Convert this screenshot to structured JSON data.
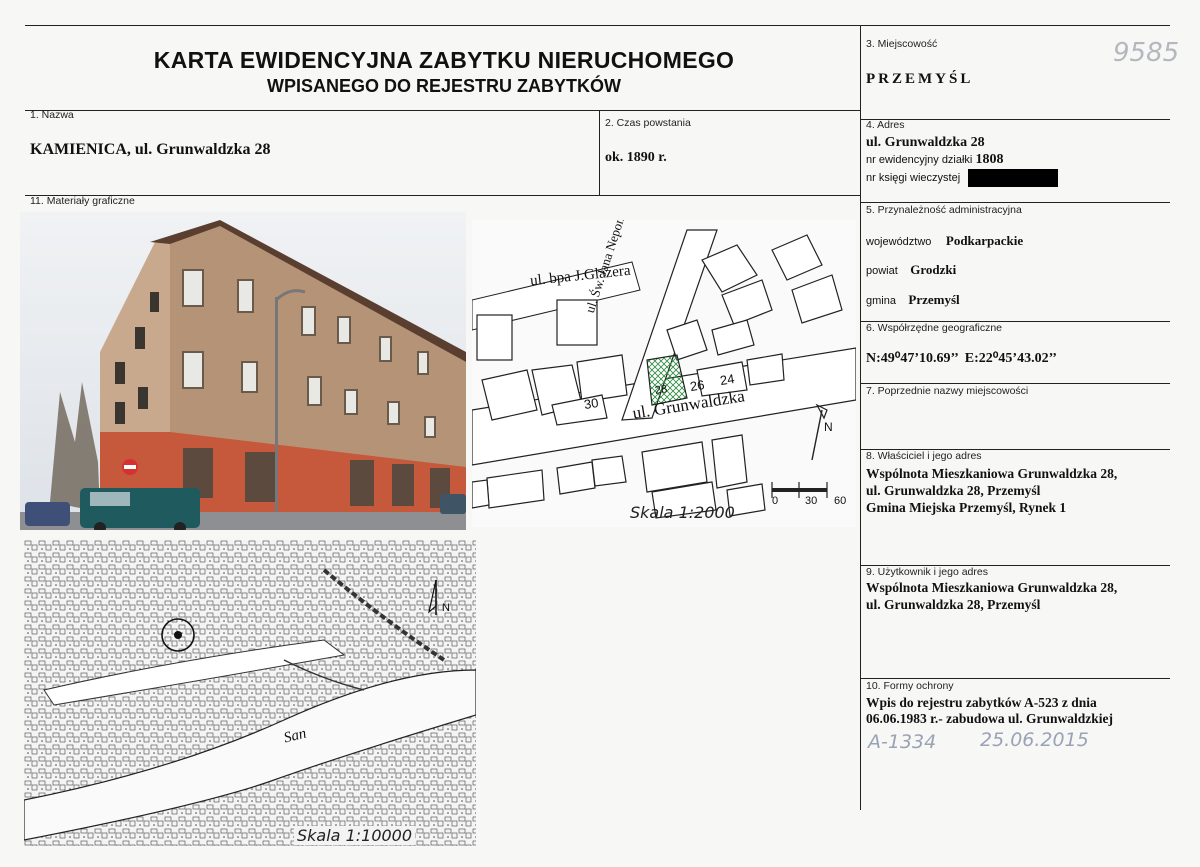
{
  "header": {
    "title_line1": "KARTA EWIDENCYJNA ZABYTKU NIERUCHOMEGO",
    "title_line2": "WPISANEGO DO REJESTRU ZABYTKÓW",
    "ref_number": "9585"
  },
  "fields": {
    "miejscowosc": {
      "label": "3. Miejscowość",
      "value": "PRZEMYŚL"
    },
    "nazwa": {
      "label": "1. Nazwa",
      "value": "KAMIENICA, ul. Grunwaldzka 28"
    },
    "czas_powstania": {
      "label": "2. Czas powstania",
      "value": "ok. 1890 r."
    },
    "adres": {
      "label": "4. Adres",
      "street": "ul. Grunwaldzka 28",
      "dzialka_label": "nr ewidencyjny działki",
      "dzialka_value": "1808",
      "ksiega_label": "nr księgi wieczystej"
    },
    "materialy": {
      "label": "11. Materiały graficzne"
    },
    "przynaleznosc": {
      "label": "5. Przynależność administracyjna",
      "wojewodztwo_label": "województwo",
      "wojewodztwo_value": "Podkarpackie",
      "powiat_label": "powiat",
      "powiat_value": "Grodzki",
      "gmina_label": "gmina",
      "gmina_value": "Przemyśl"
    },
    "wspolrzedne": {
      "label": "6. Współrzędne geograficzne",
      "value": "N:49⁰47’10.69’’  E:22⁰45’43.02’’"
    },
    "poprzednie_nazwy": {
      "label": "7. Poprzednie nazwy miejscowości"
    },
    "wlasciciel": {
      "label": "8. Właściciel i jego adres",
      "lines": [
        "Wspólnota Mieszkaniowa Grunwaldzka 28,",
        "ul. Grunwaldzka 28, Przemyśl",
        "Gmina Miejska Przemyśl, Rynek 1"
      ]
    },
    "uzytkownik": {
      "label": "9. Użytkownik i jego adres",
      "lines": [
        "Wspólnota Mieszkaniowa Grunwaldzka 28,",
        "ul. Grunwaldzka 28, Przemyśl"
      ]
    },
    "formy_ochrony": {
      "label": "10. Formy ochrony",
      "lines": [
        "Wpis do rejestru zabytków A-523 z dnia",
        "06.06.1983 r.- zabudowa ul. Grunwaldzkiej"
      ],
      "handwritten_number": "A-1334",
      "handwritten_date": "25.06.2015"
    }
  },
  "map_detail": {
    "street_glazera": "ul. bpa J.Glazera",
    "street_nepomucena": "ul. Św. Jana Nepomucena",
    "street_grunwaldzka": "ul. Grunwaldzka",
    "lot_28": "28",
    "lot_26": "26",
    "lot_24": "24",
    "lot_30": "30",
    "scale": "Skala 1:2000",
    "scale_bar_labels": [
      "0",
      "30",
      "60"
    ],
    "north": "N"
  },
  "map_overview": {
    "river": "San",
    "scale": "Skala 1:10000",
    "north": "N"
  }
}
